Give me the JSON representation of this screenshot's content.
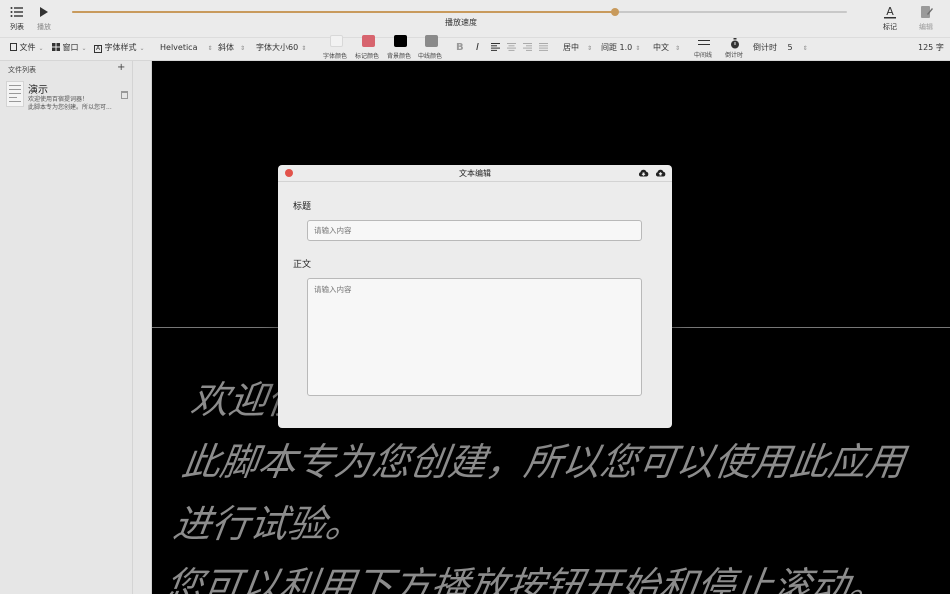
{
  "toolbar": {
    "list_label": "列表",
    "play_label": "播放",
    "speed_label": "播放速度",
    "speed_value_percent": 70,
    "mark_label": "标记",
    "edit_label": "编辑"
  },
  "format_bar": {
    "file_menu": "文件",
    "window_menu": "窗口",
    "font_style_menu": "字体样式",
    "font_family": "Helvetica",
    "font_weight": "斜体",
    "font_size_label": "字体大小",
    "font_size_value": "60",
    "swatches": [
      {
        "label": "字体颜色",
        "color": "#f2f2f2"
      },
      {
        "label": "标记颜色",
        "color": "#d7646e"
      },
      {
        "label": "背景颜色",
        "color": "#000000"
      },
      {
        "label": "中线颜色",
        "color": "#8a8a8a"
      }
    ],
    "bold_glyph": "B",
    "italic_glyph": "I",
    "alignment": "居中",
    "spacing_label": "间距",
    "spacing_value": "1.0",
    "language": "中文",
    "center_line_label": "中间线",
    "countdown_icon_label": "倒计时",
    "countdown_label": "倒计时",
    "countdown_value": "5",
    "word_count": "125 字"
  },
  "sidebar": {
    "header": "文件列表",
    "add_glyph": "+",
    "files": [
      {
        "title": "演示",
        "preview_line1": "欢迎使用百宿提词器！",
        "preview_line2": "此脚本专为您创建。所以您可..."
      }
    ]
  },
  "prompter": {
    "lines": [
      "欢迎使用百宿提词器！",
      "此脚本专为您创建，所以您可以使用此应用",
      "进行试验。",
      "您可以利用下方播放按钮开始和停止滚动。"
    ]
  },
  "modal": {
    "title": "文本编辑",
    "title_field_label": "标题",
    "title_placeholder": "请输入内容",
    "body_field_label": "正文",
    "body_placeholder": "请输入内容"
  },
  "colors": {
    "accent": "#c89a5c",
    "close_button": "#e2534b",
    "stage_background": "#000000",
    "prompter_text": "#8c8c8c"
  }
}
